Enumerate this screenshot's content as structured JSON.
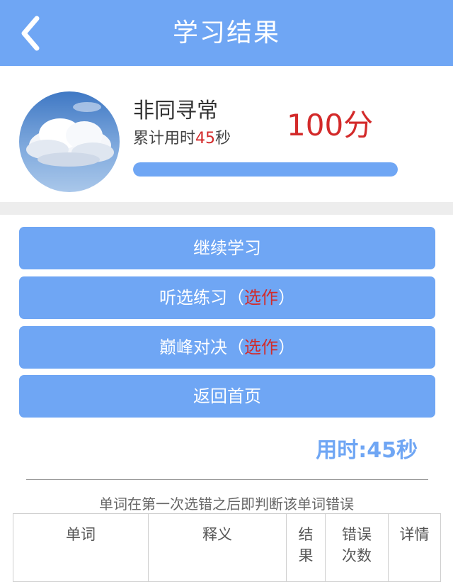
{
  "header": {
    "title": "学习结果",
    "back_icon": "chevron-left-icon"
  },
  "summary": {
    "avatar_icon": "sky-cloud-avatar",
    "name": "非同寻常",
    "time_prefix": "累计用时",
    "time_value": "45",
    "time_suffix": "秒",
    "score": "100分",
    "progress": 1.0
  },
  "actions": [
    {
      "label": "继续学习",
      "optional": ""
    },
    {
      "label": "听选练习（",
      "optional": "选作",
      "close": "）"
    },
    {
      "label": "巅峰对决（",
      "optional": "选作",
      "close": "）"
    },
    {
      "label": "返回首页",
      "optional": ""
    }
  ],
  "total_time": "用时:45秒",
  "note": "单词在第一次选错之后即判断该单词错误",
  "table": {
    "headers": [
      "单词",
      "释义",
      "结\n果",
      "错误\n次数",
      "详情"
    ]
  },
  "colors": {
    "accent": "#6fa6f4",
    "highlight": "#d32a2a",
    "background": "#ffffff"
  }
}
